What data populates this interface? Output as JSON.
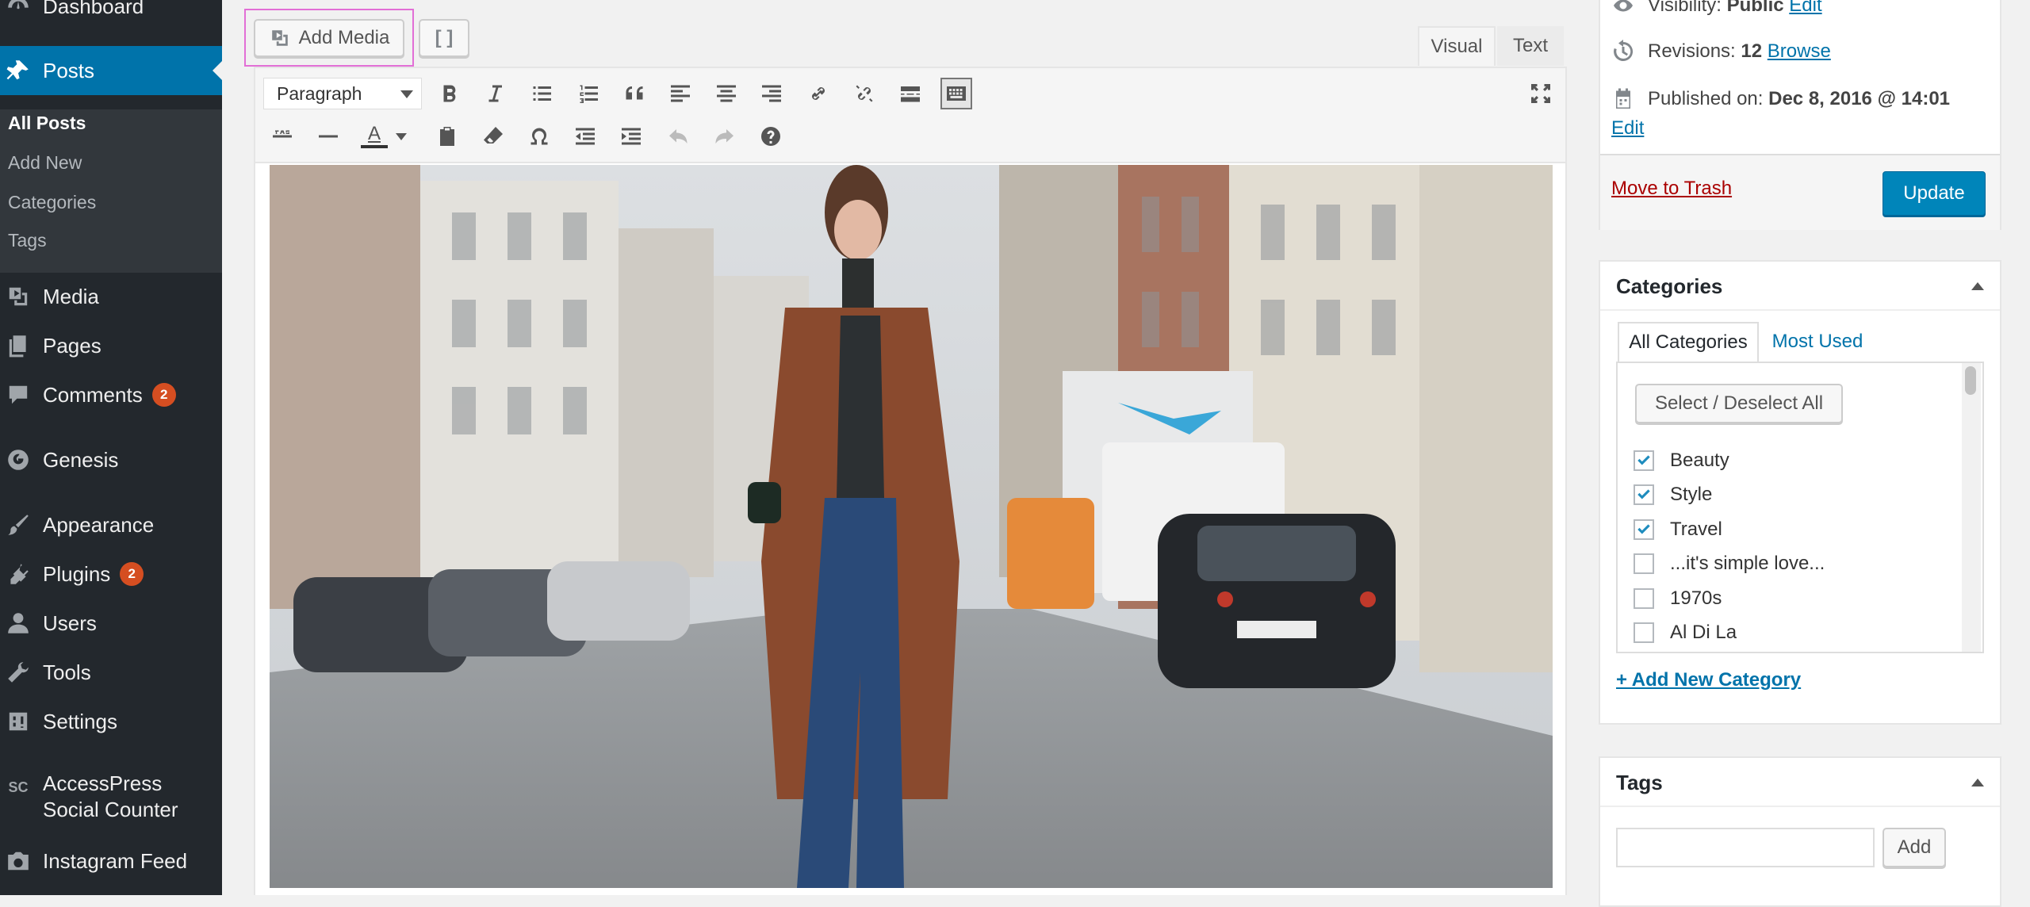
{
  "sidebar": {
    "dashboard": "Dashboard",
    "posts": "Posts",
    "posts_submenu": [
      "All Posts",
      "Add New",
      "Categories",
      "Tags"
    ],
    "media": "Media",
    "pages": "Pages",
    "comments": "Comments",
    "comments_badge": "2",
    "genesis": "Genesis",
    "appearance": "Appearance",
    "plugins": "Plugins",
    "plugins_badge": "2",
    "users": "Users",
    "tools": "Tools",
    "settings": "Settings",
    "accesspress_icon": "SC",
    "accesspress_line1": "AccessPress",
    "accesspress_line2": "Social Counter",
    "instagram": "Instagram Feed"
  },
  "editor": {
    "add_media": "Add Media",
    "shortcode_button": "[ ]",
    "tab_visual": "Visual",
    "tab_text": "Text",
    "format_select": "Paragraph",
    "text_color_letter": "A",
    "content_image": "street-fashion-photo"
  },
  "publish": {
    "visibility_label": "Visibility:",
    "visibility_value": "Public",
    "visibility_edit": "Edit",
    "revisions_label": "Revisions:",
    "revisions_count": "12",
    "revisions_browse": "Browse",
    "published_label": "Published on:",
    "published_date": "Dec 8, 2016 @ 14:01",
    "published_edit": "Edit",
    "trash": "Move to Trash",
    "update": "Update"
  },
  "categories": {
    "title": "Categories",
    "tab_all": "All Categories",
    "tab_most_used": "Most Used",
    "select_all": "Select / Deselect All",
    "items": [
      {
        "label": "Beauty",
        "checked": true
      },
      {
        "label": "Style",
        "checked": true
      },
      {
        "label": "Travel",
        "checked": true
      },
      {
        "label": "...it's simple love...",
        "checked": false
      },
      {
        "label": "1970s",
        "checked": false
      },
      {
        "label": "Al Di La",
        "checked": false
      }
    ],
    "add_new": "+ Add New Category"
  },
  "tags": {
    "title": "Tags",
    "add": "Add",
    "input_value": ""
  },
  "colors": {
    "sidebar_bg": "#23282d",
    "accent": "#0073aa",
    "badge": "#d54e21",
    "update_btn": "#0085ba",
    "highlight": "#e26fd6"
  }
}
